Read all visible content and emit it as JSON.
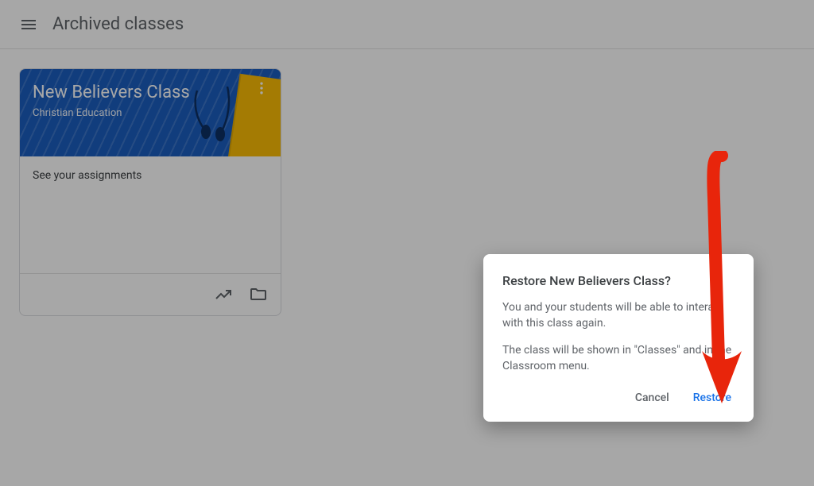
{
  "header": {
    "page_title": "Archived classes"
  },
  "class_card": {
    "title": "New Believers Class",
    "section": "Christian Education",
    "assignments_link": "See your assignments"
  },
  "dialog": {
    "title": "Restore New Believers Class?",
    "paragraph1": "You and your students will be able to interact with this class again.",
    "paragraph2": "The class will be shown in \"Classes\" and in the Classroom menu.",
    "cancel_label": "Cancel",
    "confirm_label": "Restore"
  }
}
